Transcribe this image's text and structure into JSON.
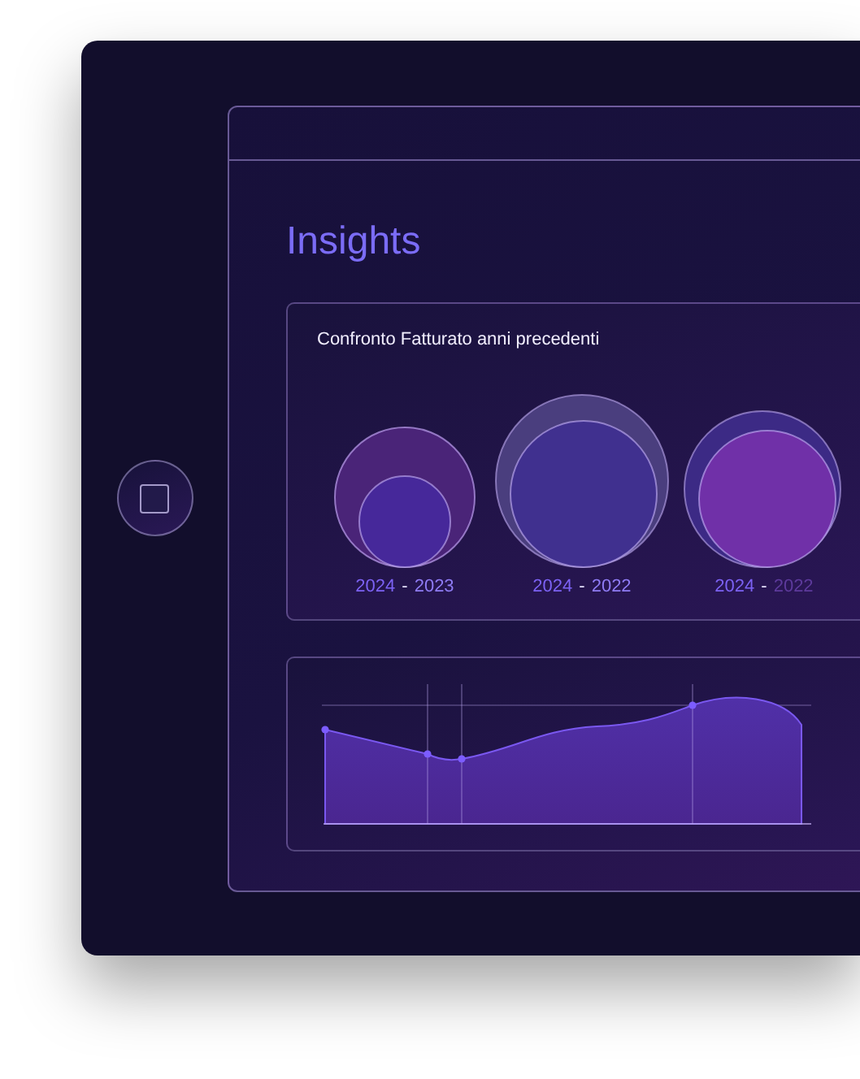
{
  "title": "Insights",
  "revenue_card": {
    "title": "Confronto Fatturato anni precedenti",
    "comparisons": [
      {
        "from": "2024",
        "separator": "-",
        "to": "2023",
        "dimmed": false
      },
      {
        "from": "2024",
        "separator": "-",
        "to": "2022",
        "dimmed": false
      },
      {
        "from": "2024",
        "separator": "-",
        "to": "2022",
        "dimmed": true
      }
    ]
  }
}
